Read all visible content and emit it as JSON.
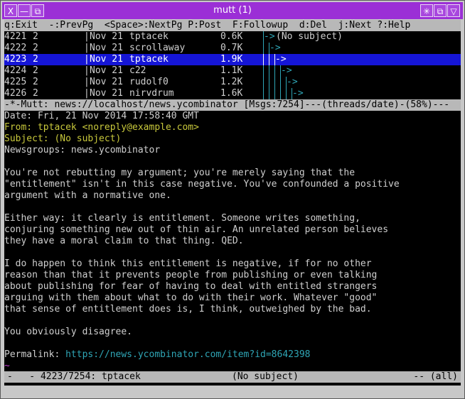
{
  "window": {
    "title": "mutt (1)",
    "left_buttons": [
      "X",
      "—",
      "⧉"
    ],
    "right_buttons": [
      "✳",
      "⧉",
      "▽"
    ]
  },
  "help_bar": "q:Exit  -:PrevPg  <Space>:NextPg P:Post  F:Followup  d:Del  j:Next ?:Help",
  "index": [
    {
      "num": "4221",
      "flag": "2",
      "sep": "|",
      "date": "Nov 21",
      "author": "tptacek",
      "size": "0.6K",
      "subject": "(No subject)",
      "depth": 0,
      "selected": false
    },
    {
      "num": "4222",
      "flag": "2",
      "sep": "|",
      "date": "Nov 21",
      "author": "scrollaway",
      "size": "0.7K",
      "subject": "",
      "depth": 1,
      "selected": false
    },
    {
      "num": "4223",
      "flag": "2",
      "sep": "|",
      "date": "Nov 21",
      "author": "tptacek",
      "size": "1.9K",
      "subject": "",
      "depth": 2,
      "selected": true
    },
    {
      "num": "4224",
      "flag": "2",
      "sep": "|",
      "date": "Nov 21",
      "author": "c22",
      "size": "1.1K",
      "subject": "",
      "depth": 3,
      "selected": false
    },
    {
      "num": "4225",
      "flag": "2",
      "sep": "|",
      "date": "Nov 21",
      "author": "rudolf0",
      "size": "1.2K",
      "subject": "",
      "depth": 4,
      "selected": false
    },
    {
      "num": "4226",
      "flag": "2",
      "sep": "|",
      "date": "Nov 21",
      "author": "nirvdrum",
      "size": "1.6K",
      "subject": "",
      "depth": 5,
      "selected": false
    }
  ],
  "index_status": "-*-Mutt: news://localhost/news.ycombinator [Msgs:7254]---(threads/date)-(58%)---",
  "headers": {
    "date": "Date: Fri, 21 Nov 2014 17:58:40 GMT",
    "from": "From: tptacek <noreply@example.com>",
    "subject": "Subject: (No subject)",
    "newsgroups": "Newsgroups: news.ycombinator"
  },
  "body": [
    "",
    "You're not rebutting my argument; you're merely saying that the",
    "\"entitlement\" isn't in this case negative. You've confounded a positive",
    "argument with a normative one.",
    "",
    "Either way: it clearly is entitlement. Someone writes something,",
    "conjuring something new out of thin air. An unrelated person believes",
    "they have a moral claim to that thing. QED.",
    "",
    "I do happen to think this entitlement is negative, if for no other",
    "reason than that it prevents people from publishing or even talking",
    "about publishing for fear of having to deal with entitled strangers",
    "arguing with them about what to do with their work. Whatever \"good\"",
    "that sense of entitlement does is, I think, outweighed by the bad.",
    "",
    "You obviously disagree.",
    ""
  ],
  "permalink": {
    "label": "Permalink: ",
    "url": "https://news.ycombinator.com/item?id=8642398"
  },
  "tilde": "~",
  "pager_status": {
    "left": "-   - 4223/7254: tptacek",
    "middle": "(No subject)",
    "right": "-- (all)"
  },
  "colors": {
    "titlebar": "#9b2fd6",
    "selection": "#1515d6",
    "thread_tree": "#2fa6b6",
    "from_subject": "#c9c93c",
    "link": "#2fa6b6",
    "tilde": "#c03bd0"
  }
}
